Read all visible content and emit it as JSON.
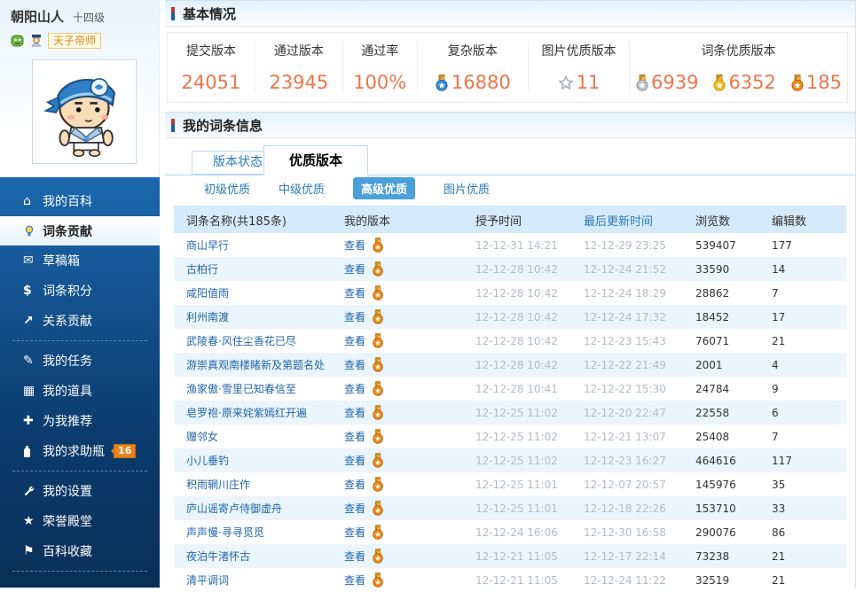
{
  "user": {
    "name": "朝阳山人",
    "level": "十四级",
    "title_badge": "天子帝师"
  },
  "sidebar": {
    "items": [
      {
        "label": "我的百科"
      },
      {
        "label": "词条贡献",
        "active": true
      },
      {
        "label": "草稿箱"
      },
      {
        "label": "词条积分"
      },
      {
        "label": "关系贡献"
      },
      {
        "label": "我的任务"
      },
      {
        "label": "我的道具"
      },
      {
        "label": "为我推荐"
      },
      {
        "label": "我的求助瓶",
        "badge": "16"
      },
      {
        "label": "我的设置"
      },
      {
        "label": "荣誉殿堂"
      },
      {
        "label": "百科收藏"
      }
    ]
  },
  "basic_info": {
    "title": "基本情况",
    "stats": [
      {
        "label": "提交版本",
        "value": "24051"
      },
      {
        "label": "通过版本",
        "value": "23945"
      },
      {
        "label": "通过率",
        "value": "100%"
      },
      {
        "label": "复杂版本",
        "value": "16880",
        "icon": "blue-medal"
      },
      {
        "label": "图片优质版本",
        "value": "11",
        "icon": "silver-star"
      },
      {
        "label": "词条优质版本",
        "medals": [
          {
            "type": "silver",
            "value": "6939"
          },
          {
            "type": "gold",
            "value": "6352"
          },
          {
            "type": "bronze",
            "value": "185"
          }
        ]
      }
    ]
  },
  "entries": {
    "title": "我的词条信息",
    "tabs": [
      {
        "label": "版本状态"
      },
      {
        "label": "优质版本",
        "active": true
      }
    ],
    "subtabs": [
      {
        "label": "初级优质"
      },
      {
        "label": "中级优质"
      },
      {
        "label": "高级优质",
        "active": true
      },
      {
        "label": "图片优质"
      }
    ],
    "table": {
      "headers": [
        "词条名称(共185条)",
        "我的版本",
        "授予时间",
        "最后更新时间",
        "浏览数",
        "编辑数"
      ],
      "view_label": "查看",
      "rows": [
        {
          "name": "商山早行",
          "granted": "12-12-31 14:21",
          "updated": "12-12-29 23:25",
          "views": "539407",
          "edits": "177"
        },
        {
          "name": "古柏行",
          "granted": "12-12-28 10:42",
          "updated": "12-12-24 21:52",
          "views": "33590",
          "edits": "14"
        },
        {
          "name": "咸阳值雨",
          "granted": "12-12-28 10:42",
          "updated": "12-12-24 18:29",
          "views": "28862",
          "edits": "7"
        },
        {
          "name": "利州南渡",
          "granted": "12-12-28 10:42",
          "updated": "12-12-24 17:32",
          "views": "18452",
          "edits": "17"
        },
        {
          "name": "武陵春·风住尘香花已尽",
          "granted": "12-12-28 10:42",
          "updated": "12-12-23 15:43",
          "views": "76071",
          "edits": "21"
        },
        {
          "name": "游崇真观南楼睹新及第题名处",
          "granted": "12-12-28 10:42",
          "updated": "12-12-22 21:49",
          "views": "2001",
          "edits": "4"
        },
        {
          "name": "渔家傲·雪里已知春信至",
          "granted": "12-12-28 10:41",
          "updated": "12-12-22 15:30",
          "views": "24784",
          "edits": "9"
        },
        {
          "name": "皂罗袍·原来姹紫嫣红开遍",
          "granted": "12-12-25 11:02",
          "updated": "12-12-20 22:47",
          "views": "22558",
          "edits": "6"
        },
        {
          "name": "赠邻女",
          "granted": "12-12-25 11:02",
          "updated": "12-12-21 13:07",
          "views": "25408",
          "edits": "7"
        },
        {
          "name": "小儿垂钓",
          "granted": "12-12-25 11:02",
          "updated": "12-12-23 16:27",
          "views": "464616",
          "edits": "117"
        },
        {
          "name": "积雨辋川庄作",
          "granted": "12-12-25 11:01",
          "updated": "12-12-07 20:57",
          "views": "145976",
          "edits": "35"
        },
        {
          "name": "庐山谣寄卢侍御虚舟",
          "granted": "12-12-25 11:01",
          "updated": "12-12-18 22:26",
          "views": "153710",
          "edits": "33"
        },
        {
          "name": "声声慢·寻寻觅觅",
          "granted": "12-12-24 16:06",
          "updated": "12-12-30 16:58",
          "views": "290076",
          "edits": "86"
        },
        {
          "name": "夜泊牛渚怀古",
          "granted": "12-12-21 11:05",
          "updated": "12-12-17 22:14",
          "views": "73238",
          "edits": "21"
        },
        {
          "name": "清平调词",
          "granted": "12-12-21 11:05",
          "updated": "12-12-24 11:22",
          "views": "32519",
          "edits": "21"
        }
      ]
    }
  },
  "colors": {
    "accent_orange": "#ee744a",
    "link_blue": "#2a7ab8",
    "sidebar_blue": "#14538f",
    "subtab_active_bg": "#4aa0d8",
    "table_header_bg": "#d5eafa"
  }
}
